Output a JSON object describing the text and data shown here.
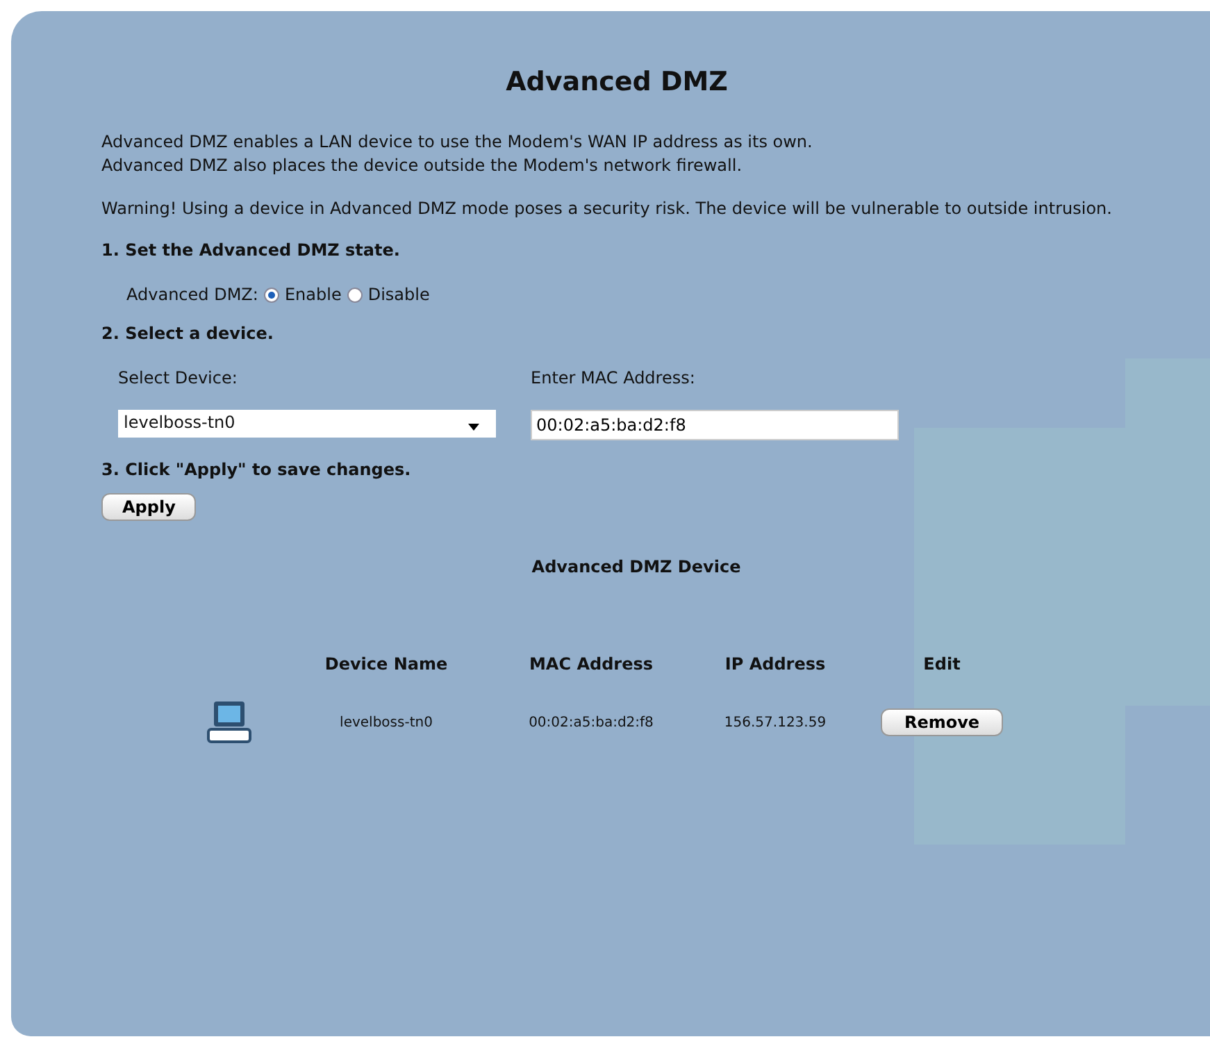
{
  "title": "Advanced DMZ",
  "intro": [
    "Advanced DMZ enables a LAN device to use the Modem's WAN IP address as its own.",
    "Advanced DMZ also places the device outside the Modem's network firewall."
  ],
  "warning": "Warning! Using a device in Advanced DMZ mode poses a security risk. The device will be vulnerable to outside intrusion.",
  "step1": {
    "heading": "1. Set the Advanced DMZ state.",
    "label": "Advanced DMZ:",
    "options": [
      {
        "label": "Enable",
        "selected": true
      },
      {
        "label": "Disable",
        "selected": false
      }
    ]
  },
  "step2": {
    "heading": "2. Select a device.",
    "select_label": "Select Device:",
    "select_value": "levelboss-tn0",
    "mac_label": "Enter MAC Address:",
    "mac_value": "00:02:a5:ba:d2:f8"
  },
  "step3": {
    "heading": "3. Click \"Apply\" to save changes.",
    "button": "Apply"
  },
  "table": {
    "title": "Advanced DMZ Device",
    "columns": [
      "Device Name",
      "MAC Address",
      "IP Address",
      "Edit"
    ],
    "rows": [
      {
        "device_name": "levelboss-tn0",
        "mac": "00:02:a5:ba:d2:f8",
        "ip": "156.57.123.59",
        "button": "Remove"
      }
    ]
  }
}
